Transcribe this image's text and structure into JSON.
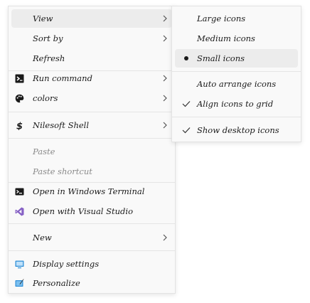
{
  "main_menu": {
    "items": [
      {
        "label": "View"
      },
      {
        "label": "Sort by"
      },
      {
        "label": "Refresh"
      },
      {
        "label": "Run command"
      },
      {
        "label": "colors"
      },
      {
        "label": "Nilesoft Shell"
      },
      {
        "label": "Paste"
      },
      {
        "label": "Paste shortcut"
      },
      {
        "label": "Open in Windows Terminal"
      },
      {
        "label": "Open with Visual Studio"
      },
      {
        "label": "New"
      },
      {
        "label": "Display settings"
      },
      {
        "label": "Personalize"
      }
    ]
  },
  "view_submenu": {
    "items": [
      {
        "label": "Large icons"
      },
      {
        "label": "Medium icons"
      },
      {
        "label": "Small icons",
        "selected": true
      },
      {
        "label": "Auto arrange icons",
        "checked": false
      },
      {
        "label": "Align icons to grid",
        "checked": true
      },
      {
        "label": "Show desktop icons",
        "checked": true
      }
    ]
  },
  "colors": {
    "accent_blue": "#2f8fd8",
    "visual_studio_purple": "#8661c5",
    "highlight": "#ececec"
  }
}
